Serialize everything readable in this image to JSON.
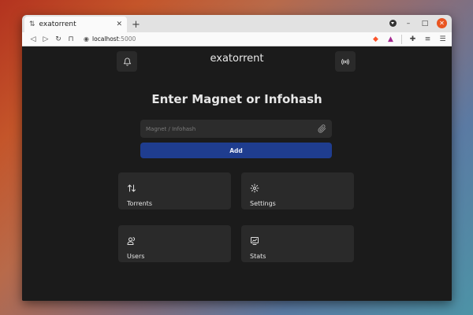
{
  "browser": {
    "tab_title": "exatorrent",
    "url_host": "localhost",
    "url_port": ":5000"
  },
  "app": {
    "brand": "exatorrent",
    "heading": "Enter Magnet or Infohash",
    "input_placeholder": "Magnet / Infohash",
    "input_value": "",
    "add_label": "Add"
  },
  "cards": [
    {
      "label": "Torrents",
      "icon": "arrows-up-down-icon"
    },
    {
      "label": "Settings",
      "icon": "gear-icon"
    },
    {
      "label": "Users",
      "icon": "users-icon"
    },
    {
      "label": "Stats",
      "icon": "chart-icon"
    }
  ],
  "colors": {
    "background": "#1b1b1b",
    "card": "#2a2a2a",
    "accent": "#1f3d8f",
    "close": "#e95420"
  }
}
